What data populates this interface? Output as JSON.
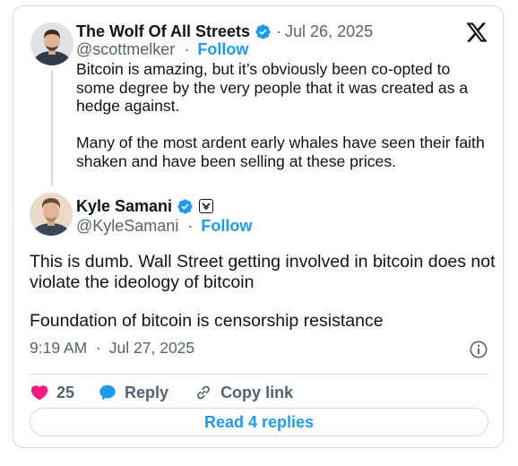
{
  "parent_tweet": {
    "author_name": "The Wolf Of All Streets",
    "verified": true,
    "date": "Jul 26, 2025",
    "handle": "@scottmelker",
    "follow_label": "Follow",
    "paragraphs": [
      "Bitcoin is amazing, but it’s obviously been co-opted to some degree by the very people that it was created as a hedge against.",
      "Many of the most ardent early whales have seen their faith shaken and have been selling at these prices."
    ]
  },
  "main_tweet": {
    "author_name": "Kyle Samani",
    "verified": true,
    "handle": "@KyleSamani",
    "follow_label": "Follow",
    "paragraphs": [
      "This is dumb. Wall Street getting involved in bitcoin does not violate the ideology of bitcoin",
      "Foundation of bitcoin is censorship resistance"
    ],
    "time": "9:19 AM",
    "date": "Jul 27, 2025"
  },
  "separator": "·",
  "actions": {
    "like_count": "25",
    "reply_label": "Reply",
    "copy_link_label": "Copy link"
  },
  "read_replies_label": "Read 4 replies",
  "icons": {
    "brand": "x-logo-icon",
    "verified": "verified-badge-icon",
    "affiliate": "affiliate-badge-icon",
    "info": "info-icon",
    "like": "heart-icon",
    "reply": "speech-bubble-icon",
    "copy": "link-icon"
  },
  "colors": {
    "accent": "#1d9bf0",
    "text": "#0f1419",
    "secondary_text": "#536471",
    "border": "#cfd9de",
    "like": "#f91880"
  }
}
